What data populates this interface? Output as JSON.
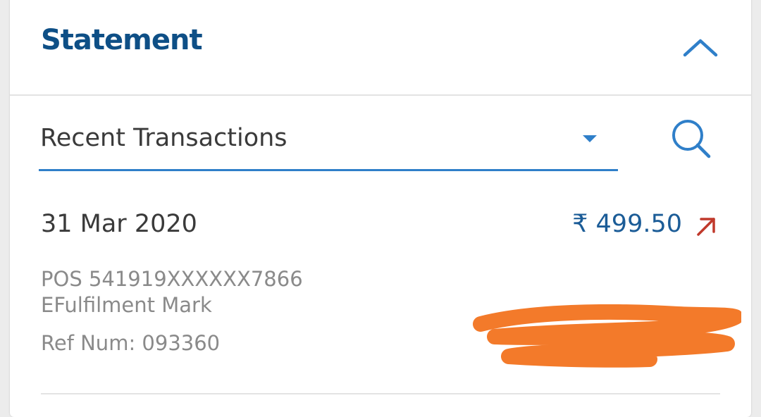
{
  "statement": {
    "title": "Statement"
  },
  "filter": {
    "selected": "Recent Transactions"
  },
  "transactions": [
    {
      "date": "31 Mar 2020",
      "amount": "₹ 499.50",
      "direction": "debit",
      "description_line1": "POS 541919XXXXXX7866",
      "description_line2": "EFulfilment Mark",
      "ref": "Ref Num: 093360"
    }
  ],
  "icons": {
    "collapse": "chevron-up-icon",
    "search": "search-icon",
    "debit": "arrow-up-right-icon"
  },
  "colors": {
    "title": "#0e4f86",
    "accent": "#2f7fc9",
    "amount": "#1b5c97",
    "debit_arrow": "#c0392b",
    "redaction": "#f37a2a"
  }
}
